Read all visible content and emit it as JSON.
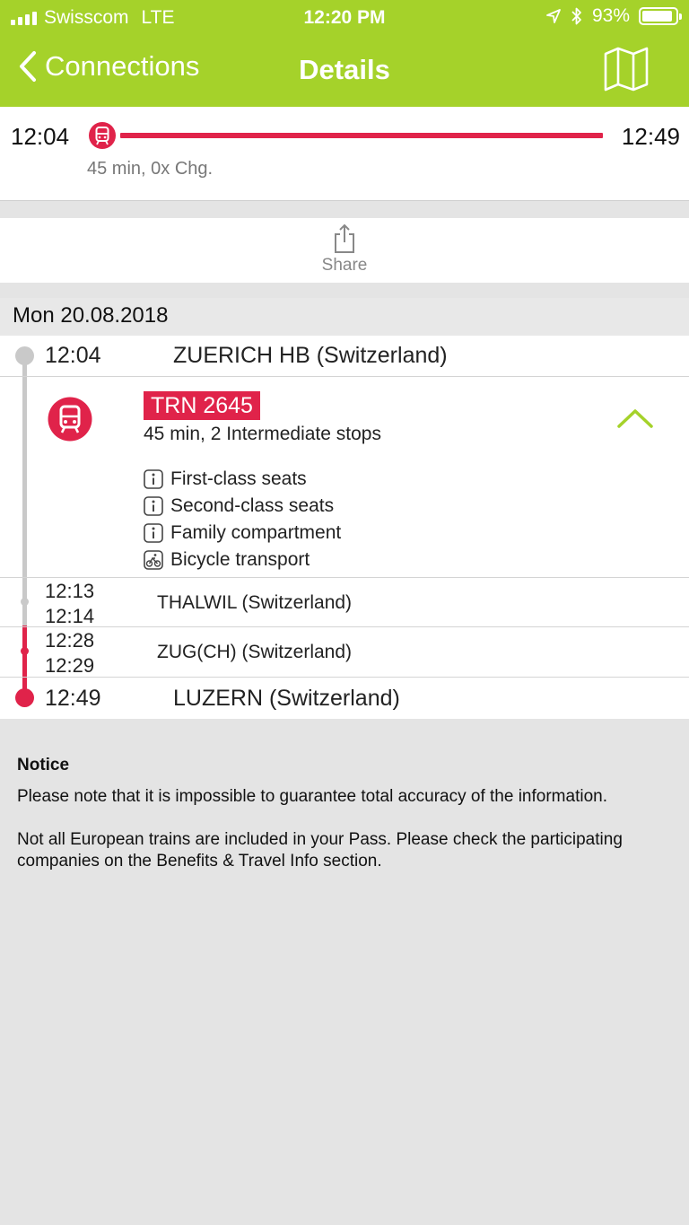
{
  "colors": {
    "accent": "#a5d22a",
    "red": "#e0234a"
  },
  "status_bar": {
    "carrier": "Swisscom",
    "network": "LTE",
    "time": "12:20 PM",
    "battery_percent": "93%",
    "battery_level": 0.93,
    "icons": [
      "signal-icon",
      "location-arrow-icon",
      "bluetooth-icon",
      "battery-icon"
    ]
  },
  "nav": {
    "back_label": "Connections",
    "title": "Details",
    "map_icon": "map-icon"
  },
  "summary": {
    "departure": "12:04",
    "arrival": "12:49",
    "info": "45 min, 0x Chg.",
    "icon": "train-icon"
  },
  "share": {
    "label": "Share",
    "icon": "share-icon"
  },
  "date": "Mon 20.08.2018",
  "journey": {
    "departure_time": "12:04",
    "departure_station": "ZUERICH HB (Switzerland)",
    "train_name": "TRN 2645",
    "train_info": "45 min, 2 Intermediate stops",
    "amenities": [
      {
        "label": "First-class seats",
        "icon": "info-icon"
      },
      {
        "label": "Second-class seats",
        "icon": "info-icon"
      },
      {
        "label": "Family compartment",
        "icon": "info-icon"
      },
      {
        "label": "Bicycle transport",
        "icon": "bicycle-icon"
      }
    ],
    "stops": [
      {
        "arrival": "12:13",
        "departure": "12:14",
        "station": "THALWIL (Switzerland)"
      },
      {
        "arrival": "12:28",
        "departure": "12:29",
        "station": "ZUG(CH) (Switzerland)"
      }
    ],
    "arrival_time": "12:49",
    "arrival_station": "LUZERN (Switzerland)"
  },
  "notice": {
    "title": "Notice",
    "paragraphs": [
      "Please note that it is impossible to guarantee total accuracy of the information.",
      "Not all European trains are included in your Pass. Please check the participating companies on the Benefits & Travel Info section."
    ]
  }
}
